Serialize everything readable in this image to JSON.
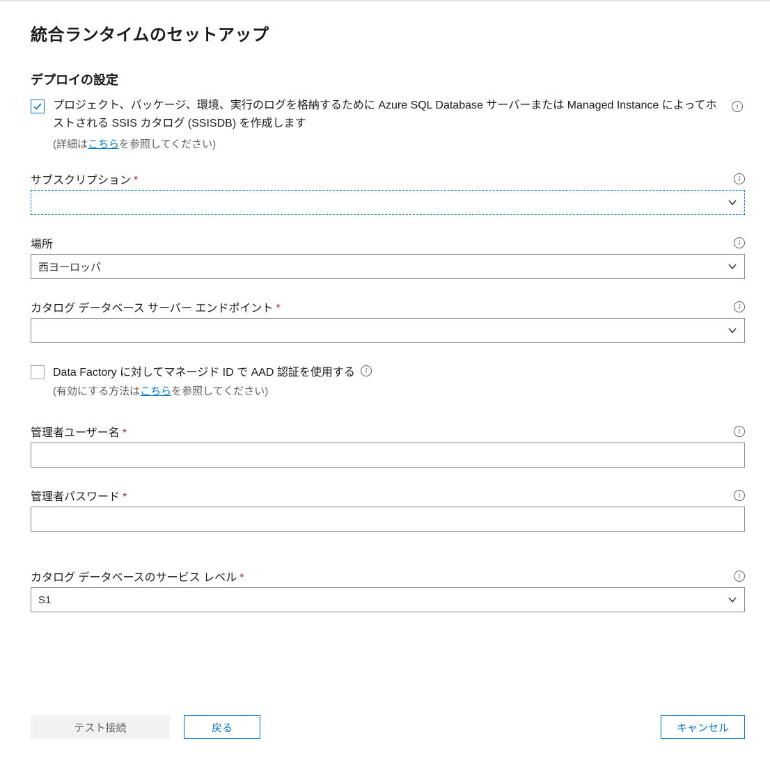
{
  "page": {
    "title": "統合ランタイムのセットアップ"
  },
  "deploy": {
    "section_title": "デプロイの設定",
    "ssisdb_checkbox_label": "プロジェクト、パッケージ、環境、実行のログを格納するために Azure SQL Database サーバーまたは Managed Instance によってホストされる SSIS カタログ (SSISDB) を作成します",
    "ssisdb_hint_prefix": "(詳細は",
    "ssisdb_hint_link": "こちら",
    "ssisdb_hint_suffix": "を参照してください)"
  },
  "fields": {
    "subscription": {
      "label": "サブスクリプション",
      "value": ""
    },
    "location": {
      "label": "場所",
      "value": "西ヨーロッパ"
    },
    "endpoint": {
      "label": "カタログ データベース サーバー エンドポイント",
      "value": ""
    },
    "aad": {
      "label": "Data Factory に対してマネージド ID で AAD 認証を使用する",
      "hint_prefix": "(有効にする方法は",
      "hint_link": "こちら",
      "hint_suffix": "を参照してください)"
    },
    "admin_user": {
      "label": "管理者ユーザー名",
      "value": ""
    },
    "admin_pass": {
      "label": "管理者パスワード",
      "value": ""
    },
    "service_level": {
      "label": "カタログ データベースのサービス レベル",
      "value": "S1"
    }
  },
  "footer": {
    "test_connection": "テスト接続",
    "back": "戻る",
    "cancel": "キャンセル"
  }
}
